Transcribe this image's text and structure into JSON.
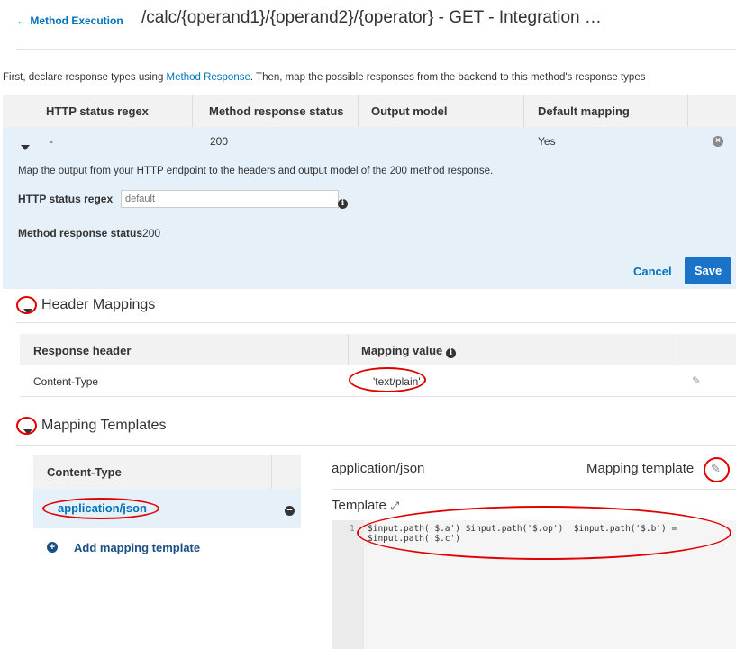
{
  "header": {
    "back_label": "← Method Execution",
    "title": "/calc/{operand1}/{operand2}/{operator} - GET - Integration …"
  },
  "intro": {
    "before": "First, declare response types using ",
    "link": "Method Response",
    "after": ". Then, map the possible responses from the backend to this method's response types"
  },
  "response_table": {
    "columns": [
      "HTTP status regex",
      "Method response status",
      "Output model",
      "Default mapping"
    ],
    "row": {
      "regex": "-",
      "status": "200",
      "model": "",
      "default": "Yes"
    }
  },
  "detail": {
    "description": "Map the output from your HTTP endpoint to the headers and output model of the 200 method response.",
    "regex_label": "HTTP status regex",
    "regex_placeholder": "default",
    "status_label": "Method response status",
    "status_value": "200",
    "cancel_label": "Cancel",
    "save_label": "Save"
  },
  "header_mappings": {
    "title": "Header Mappings",
    "columns": [
      "Response header",
      "Mapping value"
    ],
    "row": {
      "header": "Content-Type",
      "value": "'text/plain'"
    }
  },
  "mapping_templates": {
    "title": "Mapping Templates",
    "content_type_header": "Content-Type",
    "selected_type": "application/json",
    "add_label": "Add mapping template",
    "panel_title": "application/json",
    "panel_right": "Mapping template",
    "template_label": "Template",
    "code_lines": [
      {
        "num": "1",
        "text": "$input.path('$.a') $input.path('$.op')  $input.path('$.b') ="
      },
      {
        "num": "",
        "text": "$input.path('$.c')"
      }
    ]
  },
  "colors": {
    "accent": "#0073bb",
    "save": "#1a73c8",
    "highlight": "#e00000",
    "row_selected": "#e6f0f8"
  }
}
